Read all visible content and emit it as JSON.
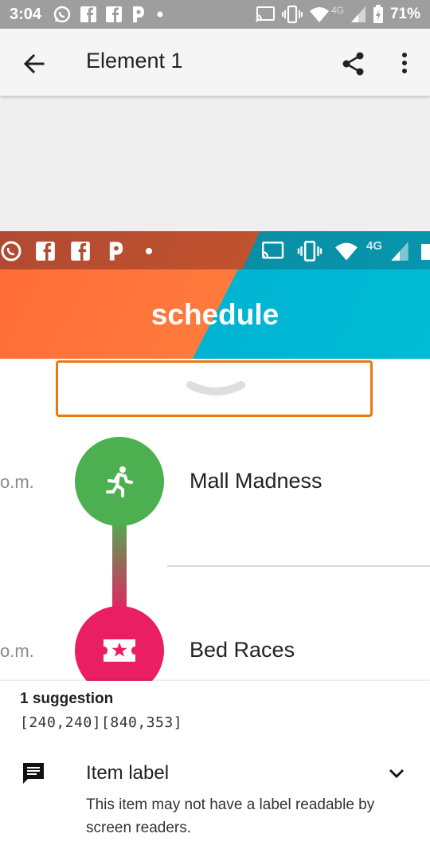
{
  "status_bar": {
    "time": "3:04",
    "battery": "71%",
    "network": "4G",
    "left_icons": [
      "whatsapp-icon",
      "facebook-icon",
      "facebook-icon",
      "pandora-icon",
      "dot-icon"
    ],
    "right_icons": [
      "cast-icon",
      "vibrate-icon",
      "wifi-icon",
      "signal-icon",
      "battery-icon"
    ]
  },
  "app_bar": {
    "title": "Element 1",
    "icons": [
      "arrow-back-icon",
      "share-icon",
      "more-vert-icon"
    ]
  },
  "embedded": {
    "network": "4G",
    "hero_title": "schedule",
    "colors": {
      "orange": "#ff6c37",
      "cyan": "#00bcd4",
      "highlight": "#e87811"
    },
    "events": [
      {
        "time_suffix": "o.m.",
        "name": "Mall Madness",
        "icon": "running-person-icon",
        "color": "#4caf50"
      },
      {
        "time_suffix": "o.m.",
        "name": "Bed Races",
        "icon": "ticket-star-icon",
        "color": "#e91e63"
      }
    ]
  },
  "suggestion_panel": {
    "count_label": "1 suggestion",
    "bounds": "[240,240][840,353]",
    "item_title": "Item label",
    "item_description": "This item may not have a label readable by screen readers.",
    "icons": [
      "message-icon",
      "chevron-down-icon"
    ]
  }
}
